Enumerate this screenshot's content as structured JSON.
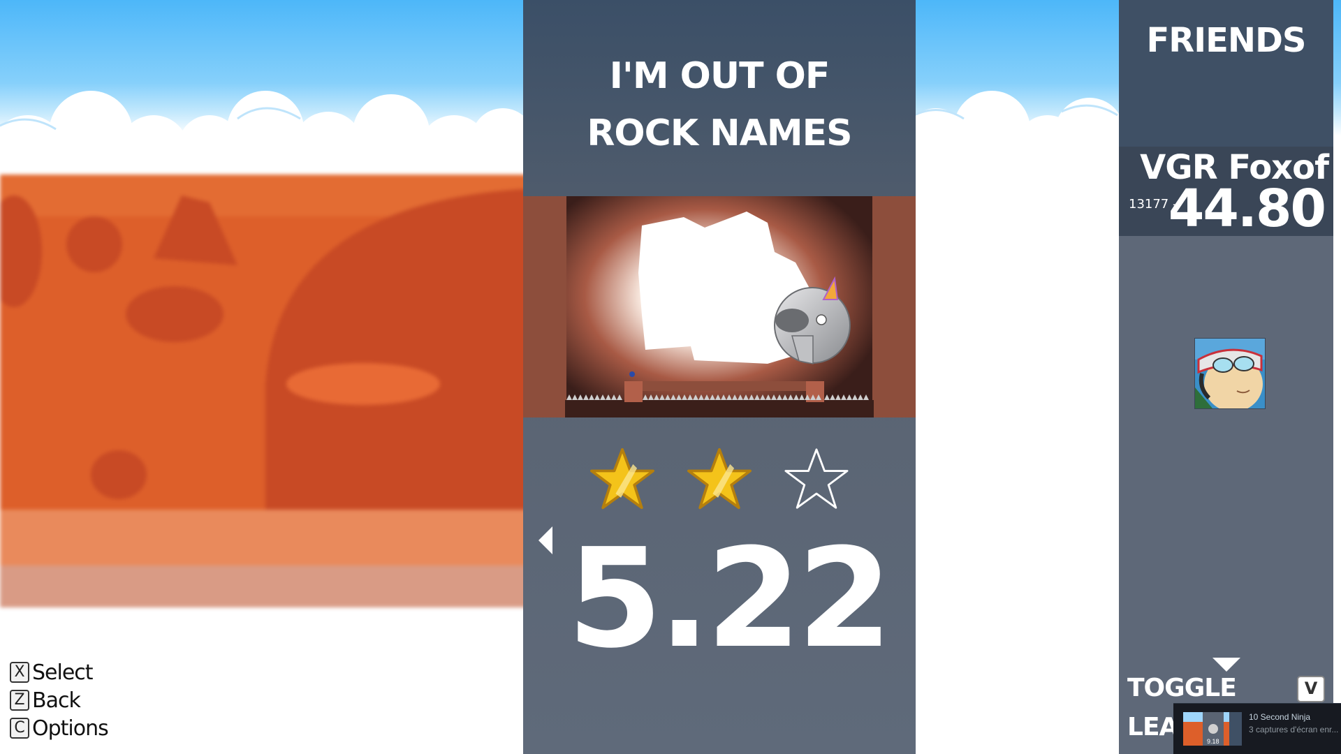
{
  "level": {
    "title_line1": "I'M OUT OF",
    "title_line2": "ROCK NAMES",
    "time": "5.22",
    "stars_earned": 2,
    "stars_total": 3
  },
  "friends": {
    "title": "FRIENDS",
    "entries": [
      {
        "name": "VGR Foxof",
        "rank": "13177 -",
        "time": "44.80"
      }
    ],
    "toggle_line1": "TOGGLE",
    "toggle_line2": "LEA",
    "toggle_key": "V"
  },
  "controls": [
    {
      "key": "X",
      "label": "Select"
    },
    {
      "key": "Z",
      "label": "Back"
    },
    {
      "key": "C",
      "label": "Options"
    }
  ],
  "notification": {
    "title": "10 Second Ninja",
    "subtitle": "3 captures d'écran enr...",
    "thumb_time": "9.18"
  },
  "colors": {
    "panel": "#5a6473",
    "panel_top": "#3b4f67",
    "star_gold": "#f4c31a",
    "mesa_orange": "#e0622a",
    "sky_blue": "#4db7f9"
  },
  "icons": {
    "prev": "triangle-left-icon",
    "more": "triangle-down-icon",
    "star_full": "star-filled-icon",
    "star_empty": "star-outline-icon"
  }
}
